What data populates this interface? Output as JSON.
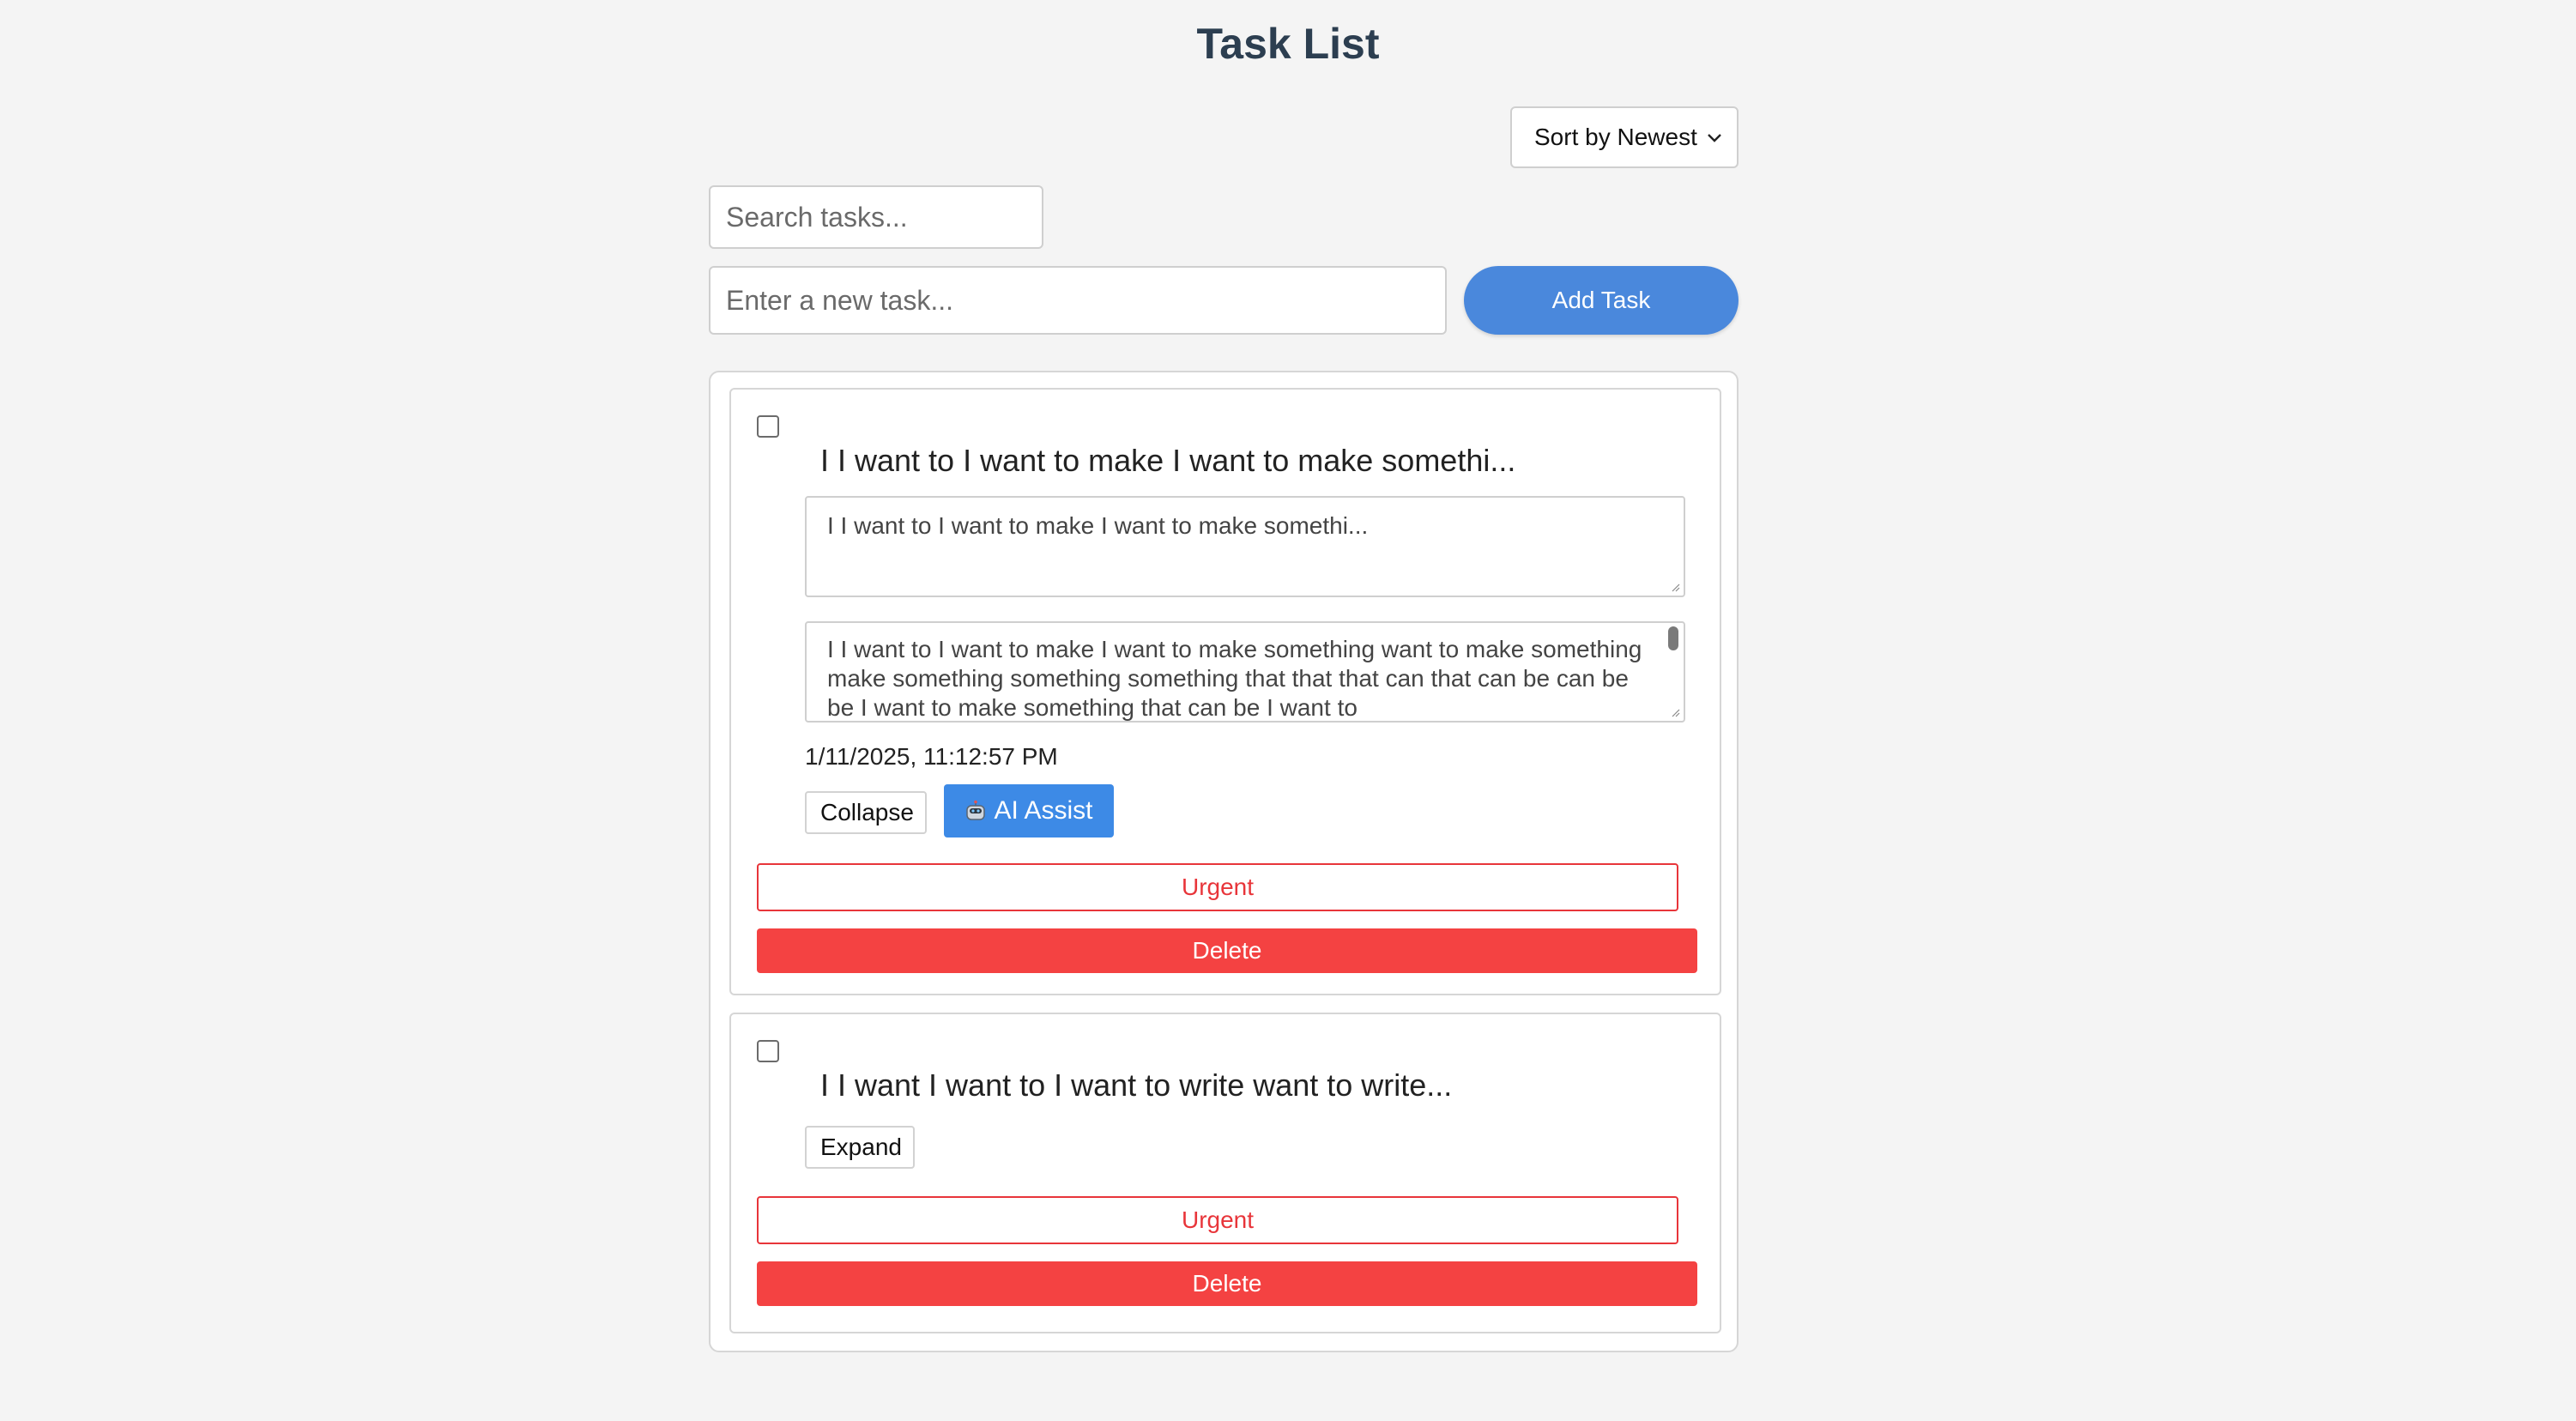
{
  "header": {
    "title": "Task List"
  },
  "controls": {
    "sort_label": "Sort by Newest",
    "search_placeholder": "Search tasks...",
    "new_task_placeholder": "Enter a new task...",
    "add_button_label": "Add Task"
  },
  "tasks": [
    {
      "title": "I I want to I want to make I want to make somethi...",
      "title_edit_value": "I I want to I want to make I want to make somethi...",
      "description_value": " I I want to I want to make I want to make something  want to make something  make something  something  something that  that  that can that can be  can be  be I want to make something that can be I want to",
      "timestamp": "1/11/2025, 11:12:57 PM",
      "collapse_label": "Collapse",
      "ai_label": "AI Assist",
      "urgent_label": "Urgent",
      "delete_label": "Delete",
      "completed": false
    },
    {
      "title": "I I want I want to I want to write  want to write...",
      "expand_label": "Expand",
      "urgent_label": "Urgent",
      "delete_label": "Delete",
      "completed": false
    }
  ],
  "colors": {
    "primary": "#4a88dc",
    "ai_button": "#3d8ae6",
    "danger": "#f44242",
    "urgent_border": "#e8353a",
    "title": "#2c3e50"
  },
  "icons": {
    "sort_chevron": "chevron-down-icon",
    "ai": "robot-icon"
  }
}
